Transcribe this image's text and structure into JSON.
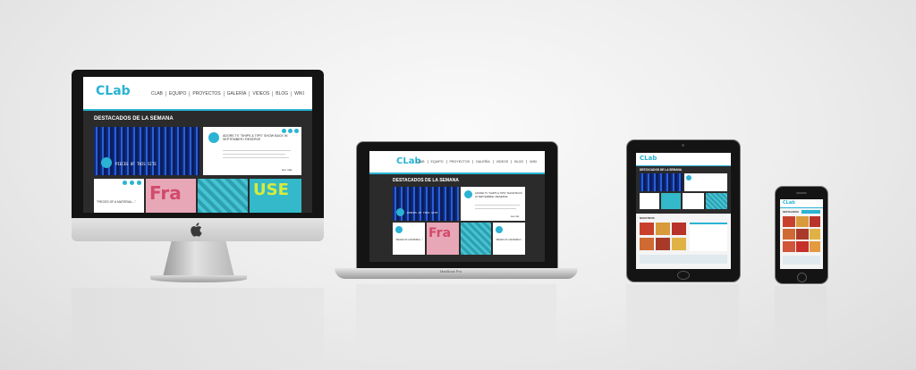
{
  "site": {
    "logo_text": "CLab",
    "nav": [
      "CLAB",
      "EQUIPO",
      "PROYECTOS",
      "GALERÍA",
      "VIDEOS",
      "BLOG",
      "WIKI"
    ],
    "heading": "DESTACADOS DE LA SEMANA",
    "featured_title": "ADORE TV \"SHIPS & TIPS\" SHOW BACK IN SEPTEMBER I RESERVE",
    "tile_caption_1": "PIECES OF THIS SITE",
    "tile_caption_2": "\"PIECES OF A MATERIAL...\"",
    "tile_caption_3": "\"PIECES OF A MATERIAL\" ...",
    "read_more": "leer más",
    "tile_words": [
      "USE",
      "Fra"
    ]
  },
  "laptop": {
    "brand": "MacBook Pro"
  },
  "tablet": {
    "section_label": "NUESTROS"
  },
  "phone": {
    "section_label": "DESTACADOS"
  },
  "colors": {
    "accent": "#2ab3d4",
    "screen_dark": "#2b2b2b",
    "bezel": "#151515"
  }
}
